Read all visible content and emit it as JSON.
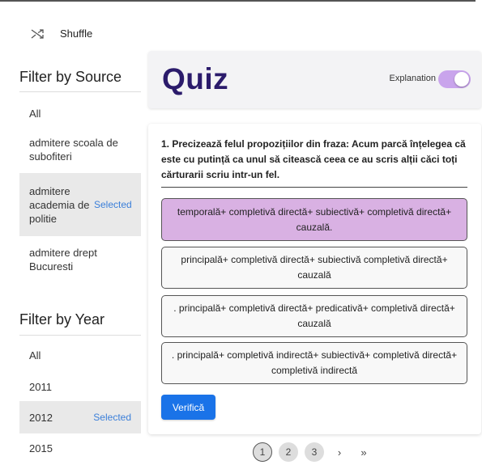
{
  "sidebar": {
    "shuffle_label": "Shuffle",
    "source": {
      "title": "Filter by Source",
      "items": [
        {
          "label": "All",
          "tag": ""
        },
        {
          "label": "admitere scoala de subofiteri",
          "tag": ""
        },
        {
          "label": "admitere academia de politie",
          "tag": "Selected"
        },
        {
          "label": "admitere drept Bucuresti",
          "tag": ""
        }
      ]
    },
    "year": {
      "title": "Filter by Year",
      "items": [
        {
          "label": "All",
          "tag": ""
        },
        {
          "label": "2011",
          "tag": ""
        },
        {
          "label": "2012",
          "tag": "Selected"
        },
        {
          "label": "2015",
          "tag": ""
        }
      ]
    }
  },
  "header": {
    "title": "Quiz",
    "explanation_label": "Explanation",
    "explanation_on": true
  },
  "question": {
    "text": "1. Precizează felul propozițiilor din fraza: Acum parcă înțelegea că este cu putință ca unul să citească ceea ce au scris alții căci toți cărturarii scriu intr-un fel.",
    "options": [
      "temporală+ completivă directă+ subiectivă+ completivă directă+ cauzală.",
      "principală+ completivă directă+ subiectivă completivă directă+ cauzală",
      ". principală+ completivă directă+ predicativă+ completivă directă+ cauzală",
      ". principală+ completivă indirectă+ subiectivă+ completivă directă+ completivă indirectă"
    ],
    "selected_index": 0,
    "verify_label": "Verifică"
  },
  "pagination": {
    "pages": [
      "1",
      "2",
      "3"
    ],
    "current": "1",
    "next": "›",
    "last": "»"
  },
  "colors": {
    "accent": "#1a73e8",
    "selected_option": "#d9b1e3",
    "toggle": "#c9a4ec",
    "title": "#2b1b6b",
    "selected_tag": "#3b7fd9"
  },
  "icons": {
    "shuffle": "shuffle-icon"
  }
}
